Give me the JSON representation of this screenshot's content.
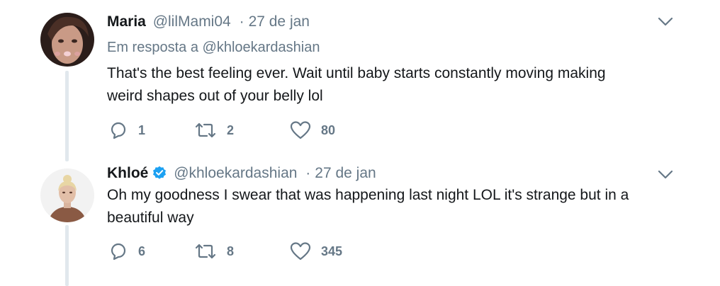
{
  "colors": {
    "text": "#14171a",
    "secondary": "#657786",
    "thread_line": "#e1e8ed",
    "verified": "#1da1f2"
  },
  "tweets": [
    {
      "name": "Maria",
      "handle": "@lilMami04",
      "separator": "·",
      "date": "27 de jan",
      "reply_prefix": "Em resposta a",
      "reply_handle": "@khloekardashian",
      "text_line1": "That's the best feeling ever. Wait until baby starts constantly moving making",
      "text_line2": "weird shapes out of your belly lol",
      "replies": "1",
      "retweets": "2",
      "likes": "80",
      "verified": false
    },
    {
      "name": "Khloé",
      "handle": "@khloekardashian",
      "separator": "·",
      "date": "27 de jan",
      "text_line1": "Oh my goodness I swear that was happening last night LOL it's strange but in a",
      "text_line2": "beautiful way",
      "replies": "6",
      "retweets": "8",
      "likes": "345",
      "verified": true
    }
  ],
  "icons": {
    "reply": "reply-icon",
    "retweet": "retweet-icon",
    "like": "heart-icon",
    "more": "chevron-down-icon",
    "verified": "verified-badge-icon"
  }
}
